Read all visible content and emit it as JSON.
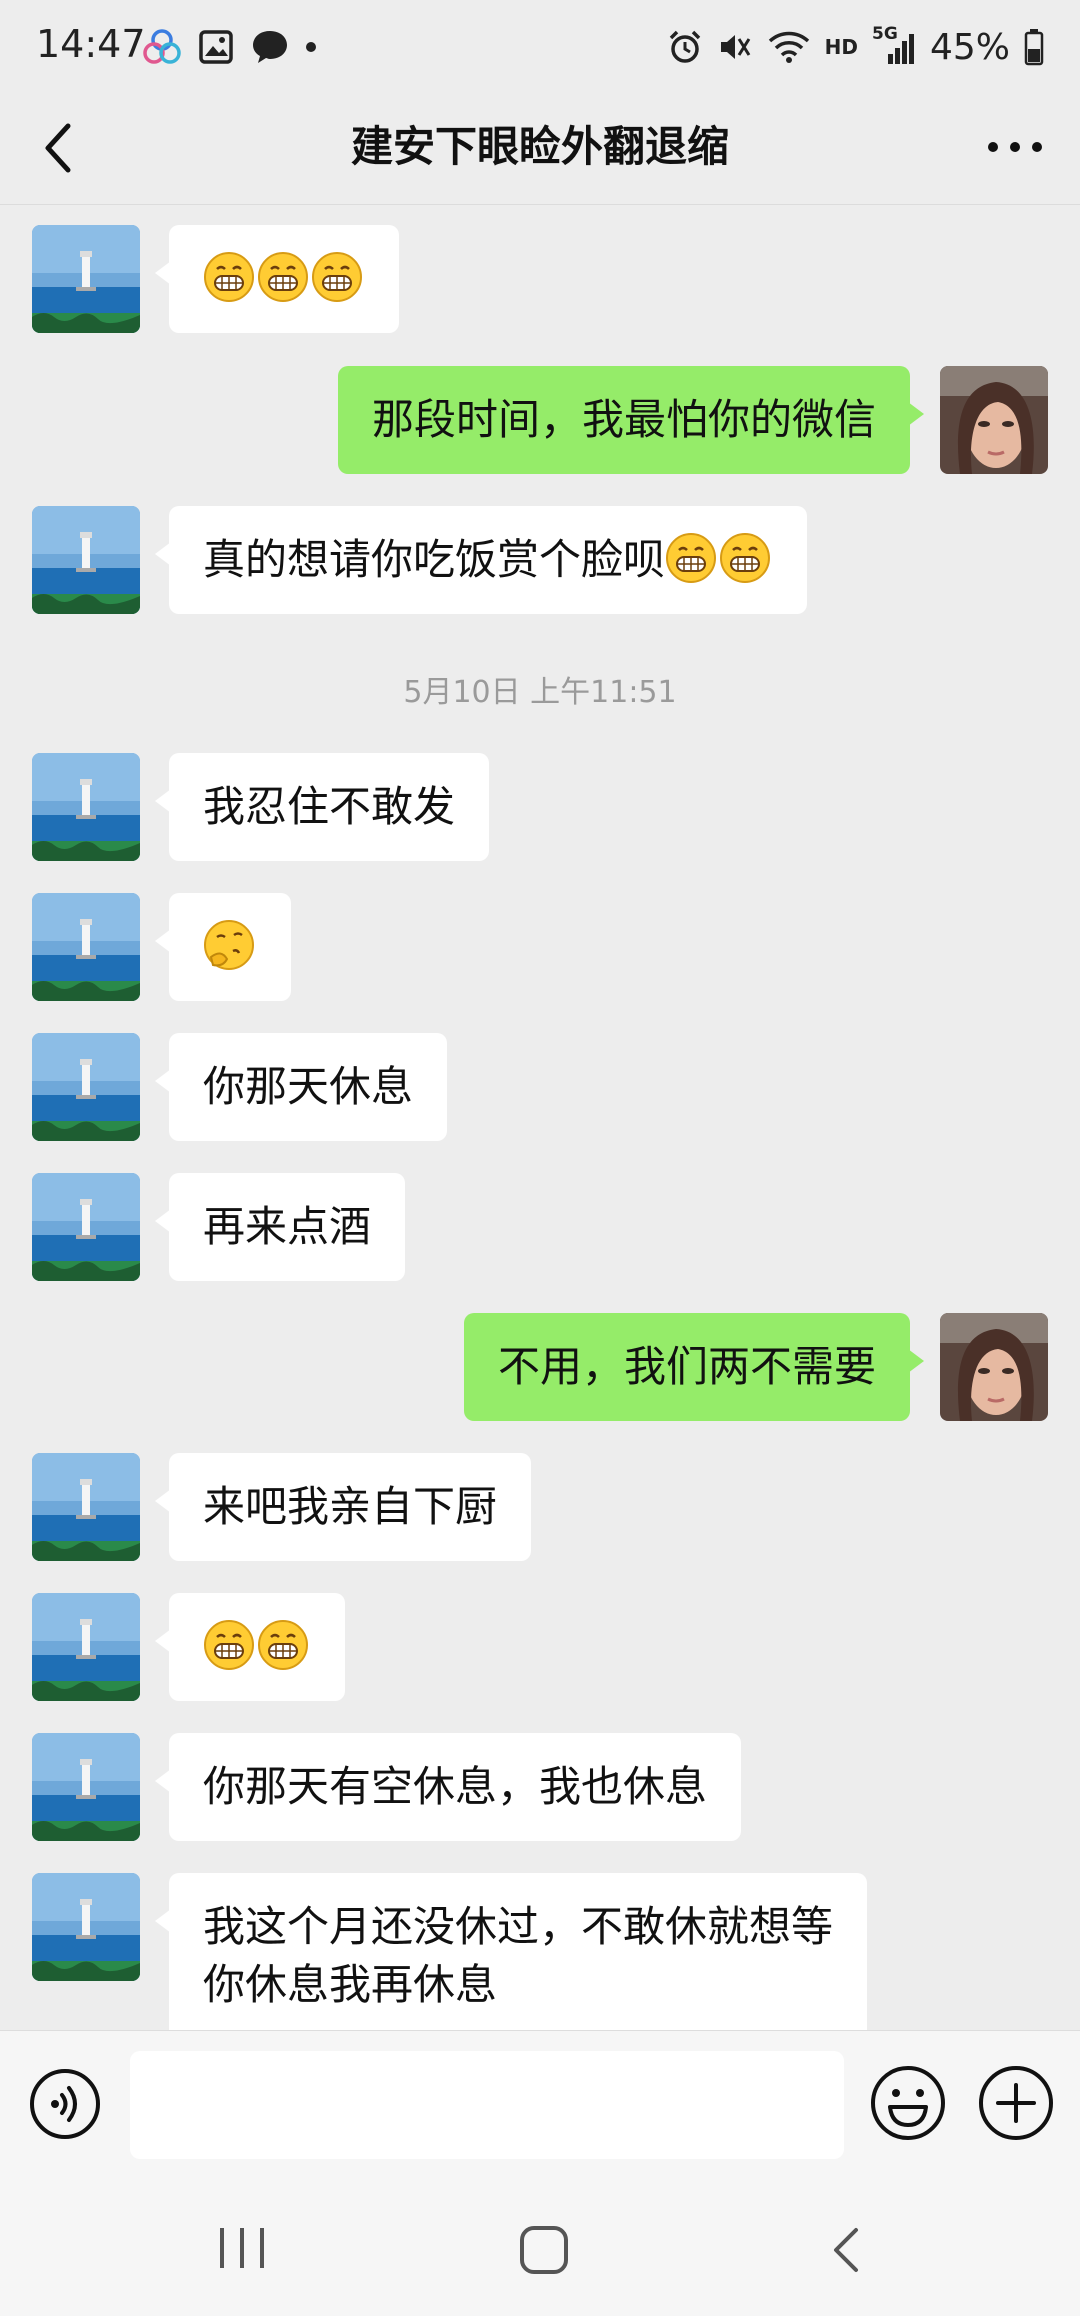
{
  "status_bar": {
    "time": "14:47",
    "network": "5G",
    "hd_label": "HD",
    "battery": "45%"
  },
  "header": {
    "title": "建安下眼睑外翻退缩"
  },
  "messages": [
    {
      "side": "in",
      "text": "",
      "emojis": 3
    },
    {
      "side": "out",
      "text": "那段时间，我最怕你的微信"
    },
    {
      "side": "in",
      "text": "真的想请你吃饭赏个脸呗",
      "emojis": 2
    },
    {
      "timestamp": "5月10日 上午11:51"
    },
    {
      "side": "in",
      "text": "我忍住不敢发"
    },
    {
      "side": "in",
      "text": "",
      "emoji": "thinking"
    },
    {
      "side": "in",
      "text": "你那天休息"
    },
    {
      "side": "in",
      "text": "再来点酒"
    },
    {
      "side": "out",
      "text": "不用，我们两不需要"
    },
    {
      "side": "in",
      "text": "来吧我亲自下厨"
    },
    {
      "side": "in",
      "text": "",
      "emojis": 2
    },
    {
      "side": "in",
      "text": "你那天有空休息，我也休息"
    },
    {
      "side": "in",
      "lines": [
        "我这个月还没休过，不敢休就想等",
        "你休息我再休息"
      ]
    }
  ],
  "input_bar": {
    "placeholder": ""
  },
  "colors": {
    "background": "#ededed",
    "outgoing_bubble": "#95ec69",
    "incoming_bubble": "#ffffff"
  },
  "icons": [
    "back-icon",
    "more-icon",
    "voice-icon",
    "emoji-icon",
    "plus-icon",
    "nav-recent-icon",
    "nav-home-icon",
    "nav-back-icon"
  ]
}
